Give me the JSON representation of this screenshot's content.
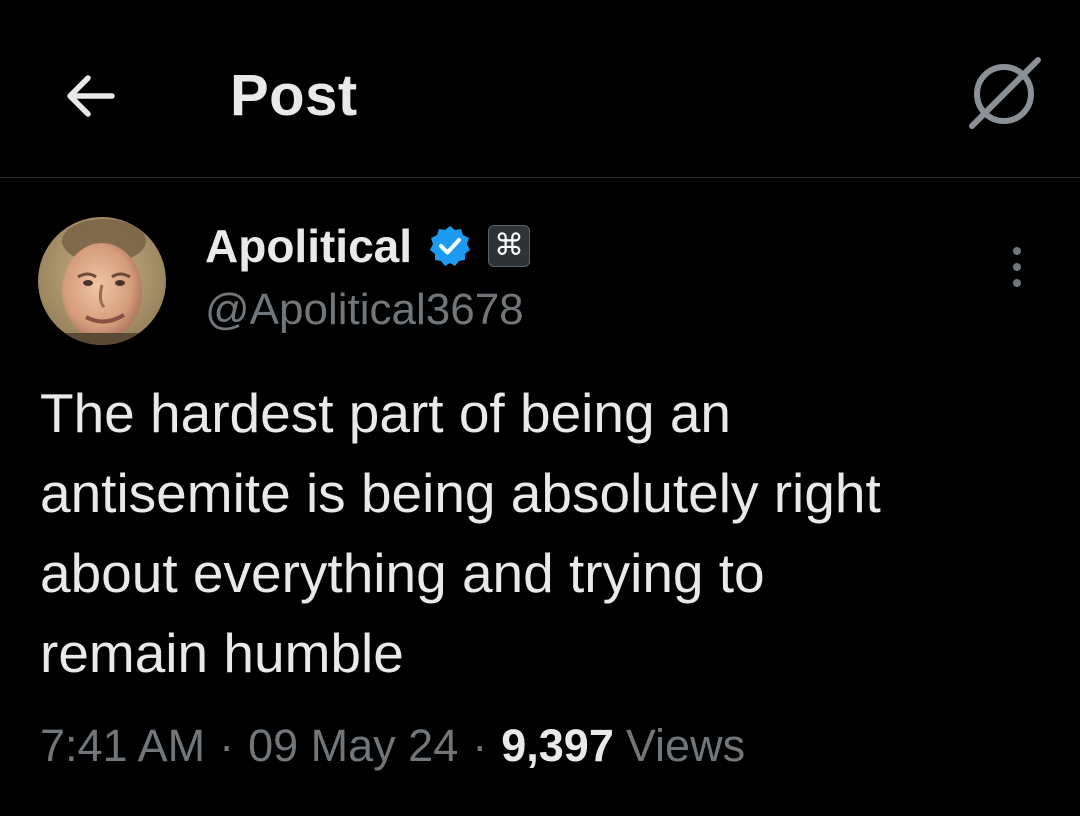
{
  "header": {
    "title": "Post",
    "back_icon": "arrow-left-icon",
    "right_icon": "slashed-circle-icon"
  },
  "author": {
    "display_name": "Apolitical",
    "handle": "@Apolitical3678",
    "verified_icon": "verified-badge-icon",
    "verified_color": "#1d9bf0",
    "affiliate_badge_glyph": "⌘",
    "avatar_icon": "profile-avatar"
  },
  "more_icon": "more-vertical-icon",
  "post": {
    "lines": [
      "The hardest part of being an",
      "antisemite is being absolutely right",
      "about everything and trying to",
      "remain humble"
    ]
  },
  "meta": {
    "time": "7:41 AM",
    "separator": "·",
    "date": "09 May 24",
    "views_count": "9,397",
    "views_label": "Views"
  },
  "colors": {
    "background": "#000000",
    "text_primary": "#e7e9ea",
    "text_secondary": "#71767b",
    "divider": "#2f3336",
    "accent": "#1d9bf0"
  }
}
